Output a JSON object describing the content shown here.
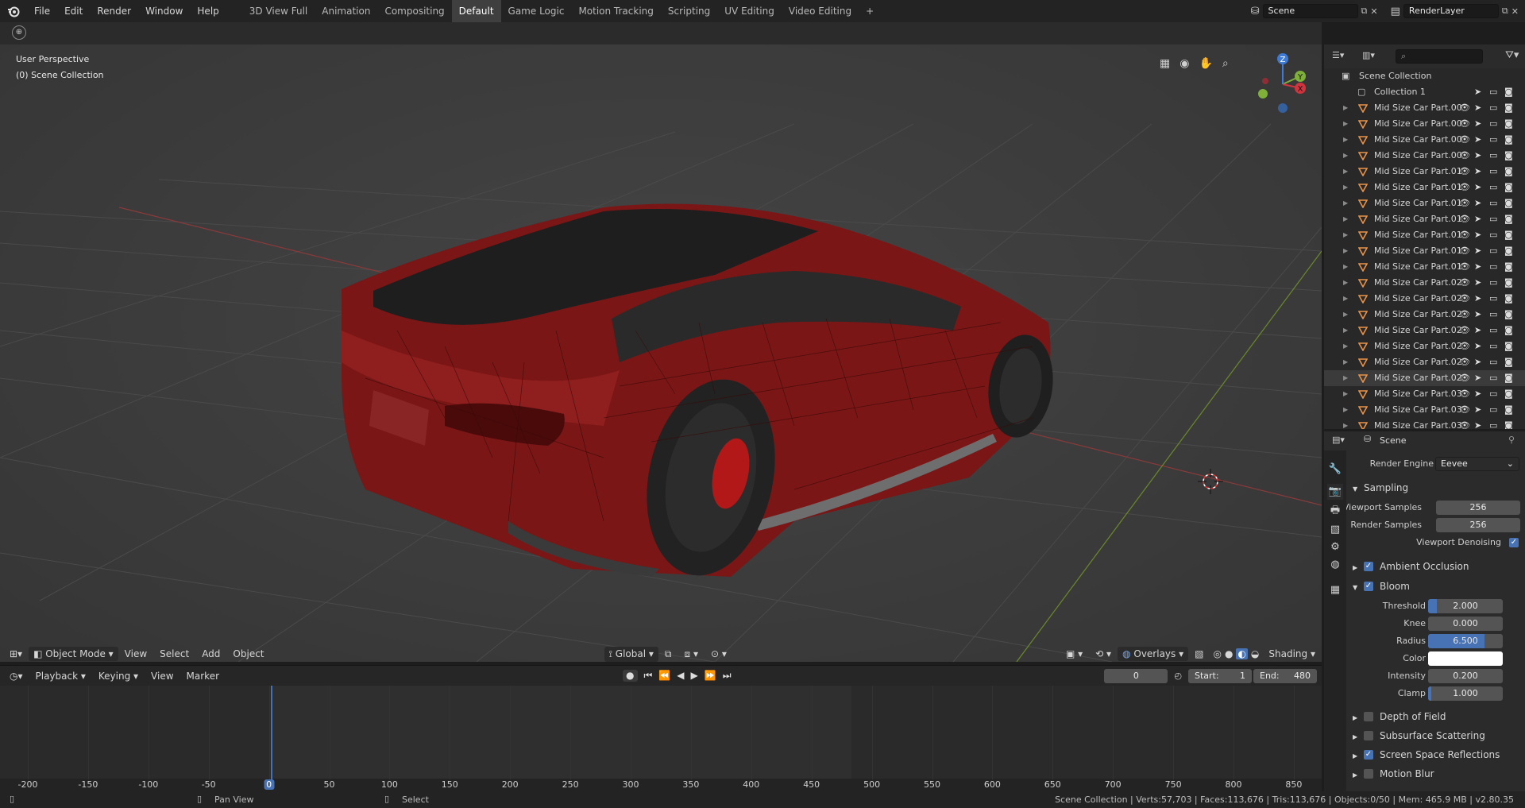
{
  "menu": [
    "File",
    "Edit",
    "Render",
    "Window",
    "Help"
  ],
  "workspaces": [
    "3D View Full",
    "Animation",
    "Compositing",
    "Default",
    "Game Logic",
    "Motion Tracking",
    "Scripting",
    "UV Editing",
    "Video Editing"
  ],
  "active_workspace": "Default",
  "add_workspace_label": "+",
  "scene_field": "Scene",
  "view_layer_field": "RenderLayer",
  "viewport": {
    "view_name": "User Perspective",
    "collection_label": "(0) Scene Collection",
    "gizmo_axes": {
      "x": "X",
      "y": "Y",
      "z": "Z"
    },
    "header": {
      "mode": "Object Mode",
      "menus": [
        "View",
        "Select",
        "Add",
        "Object"
      ],
      "transform_orientation": "Global",
      "overlays": "Overlays",
      "shading": "Shading"
    }
  },
  "timeline": {
    "menus": [
      "Playback",
      "Keying",
      "View",
      "Marker"
    ],
    "current_frame": "0",
    "start_label": "Start:",
    "start_value": "1",
    "end_label": "End:",
    "end_value": "480",
    "ticks": [
      "-200",
      "-150",
      "-100",
      "-50",
      "0",
      "50",
      "100",
      "150",
      "200",
      "250",
      "300",
      "350",
      "400",
      "450",
      "500",
      "550",
      "600",
      "650",
      "700",
      "750",
      "800",
      "850"
    ]
  },
  "outliner": {
    "root": "Scene Collection",
    "collection": "Collection 1",
    "items": [
      "Mid Size Car Part.00",
      "Mid Size Car Part.00",
      "Mid Size Car Part.00",
      "Mid Size Car Part.00",
      "Mid Size Car Part.01",
      "Mid Size Car Part.01",
      "Mid Size Car Part.01",
      "Mid Size Car Part.01",
      "Mid Size Car Part.01",
      "Mid Size Car Part.01",
      "Mid Size Car Part.01",
      "Mid Size Car Part.02",
      "Mid Size Car Part.02",
      "Mid Size Car Part.02",
      "Mid Size Car Part.02",
      "Mid Size Car Part.02",
      "Mid Size Car Part.02",
      "Mid Size Car Part.02",
      "Mid Size Car Part.03",
      "Mid Size Car Part.03",
      "Mid Size Car Part.03"
    ]
  },
  "properties": {
    "context": "Scene",
    "render_engine_label": "Render Engine",
    "render_engine": "Eevee",
    "sampling": {
      "title": "Sampling",
      "viewport_samples_label": "Viewport Samples",
      "viewport_samples": "256",
      "render_samples_label": "Render Samples",
      "render_samples": "256",
      "denoise_label": "Viewport Denoising"
    },
    "ambient_occlusion": "Ambient Occlusion",
    "bloom": {
      "title": "Bloom",
      "threshold_label": "Threshold",
      "threshold": "2.000",
      "threshold_fill": 0.12,
      "knee_label": "Knee",
      "knee": "0.000",
      "knee_fill": 0,
      "radius_label": "Radius",
      "radius": "6.500",
      "radius_fill": 0.76,
      "color_label": "Color",
      "intensity_label": "Intensity",
      "intensity": "0.200",
      "intensity_fill": 0,
      "clamp_label": "Clamp",
      "clamp": "1.000",
      "clamp_fill": 0.04
    },
    "depth_of_field": "Depth of Field",
    "subsurface": "Subsurface Scattering",
    "ssr": "Screen Space Reflections",
    "motion_blur": "Motion Blur"
  },
  "status": {
    "pan": "Pan View",
    "select": "Select",
    "stats": "Scene Collection | Verts:57,703 | Faces:113,676 | Tris:113,676 | Objects:0/50 | Mem: 465.9 MB | v2.80.35"
  },
  "colors": {
    "accent": "#4772b3",
    "car_body": "#8a1c1c",
    "grid_x": "#8a3a3a",
    "grid_y": "#6b8a2a",
    "object_icon": "#e8924a"
  }
}
